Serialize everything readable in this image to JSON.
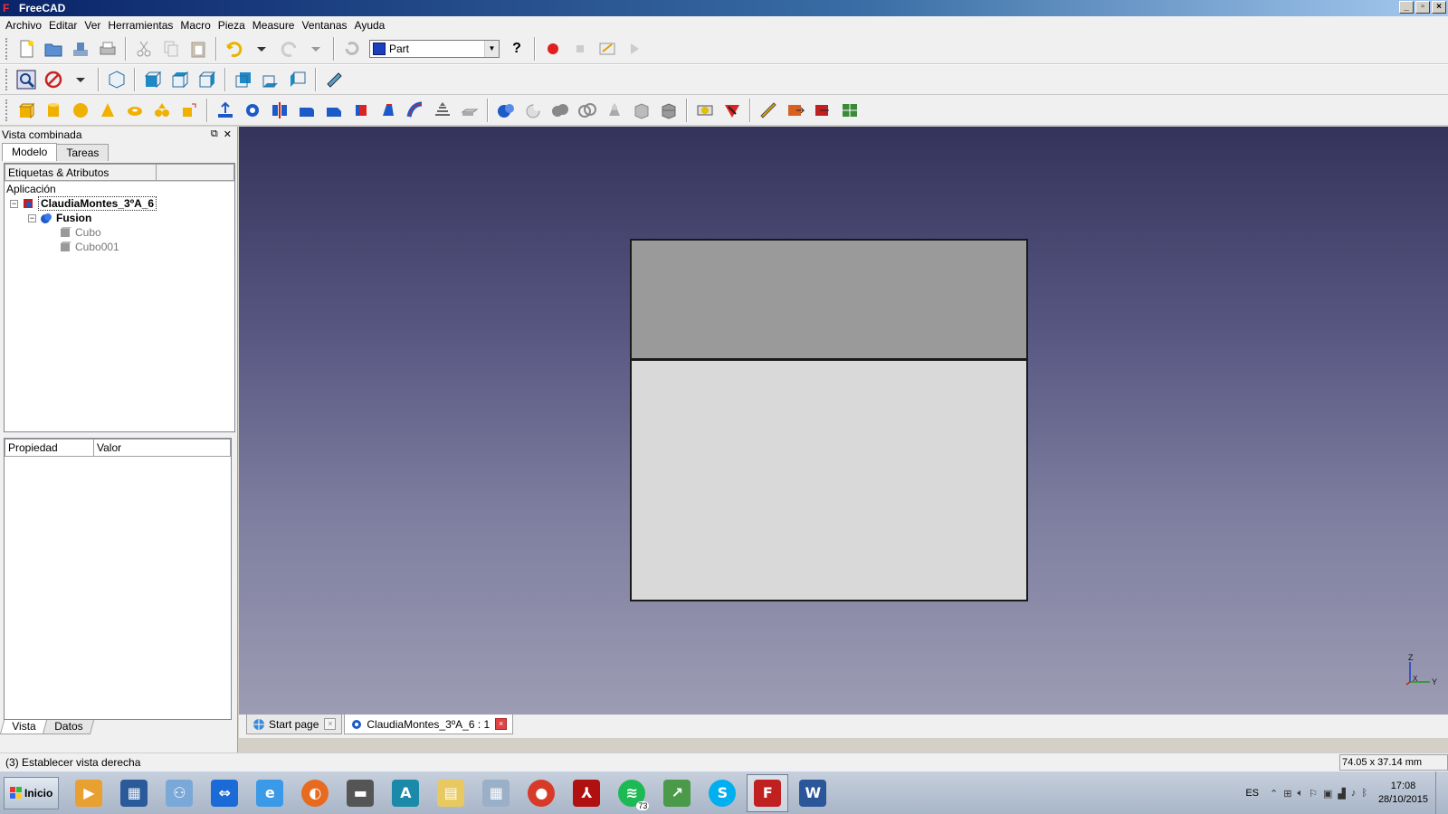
{
  "window": {
    "title": "FreeCAD",
    "buttons": [
      "_",
      "▫",
      "×"
    ]
  },
  "menu": [
    "Archivo",
    "Editar",
    "Ver",
    "Herramientas",
    "Macro",
    "Pieza",
    "Measure",
    "Ventanas",
    "Ayuda"
  ],
  "toolbar": {
    "workbench": "Part",
    "help_label": "?"
  },
  "left_panel": {
    "title": "Vista combinada",
    "tabs": [
      "Modelo",
      "Tareas"
    ],
    "tree_header": "Etiquetas & Atributos",
    "root_label": "Aplicación",
    "document": "ClaudiaMontes_3ºA_6",
    "fusion": "Fusion",
    "children": [
      "Cubo",
      "Cubo001"
    ],
    "prop_headers": [
      "Propiedad",
      "Valor"
    ],
    "bottom_tabs": [
      "Vista",
      "Datos"
    ]
  },
  "viewport": {
    "axis": {
      "z": "Z",
      "x": "X",
      "y": "Y"
    }
  },
  "doc_tabs": [
    {
      "label": "Start page",
      "close": "×"
    },
    {
      "label": "ClaudiaMontes_3ºA_6 : 1",
      "close": "×"
    }
  ],
  "status": {
    "message": "(3) Establecer vista derecha",
    "dimensions": "74.05 x 37.14 mm"
  },
  "taskbar": {
    "start_label": "Inicio",
    "language": "ES",
    "time": "17:08",
    "date": "28/10/2015",
    "spotify_badge": "73",
    "apps": [
      "media-player",
      "toolbox",
      "network",
      "teamviewer",
      "internet-explorer",
      "firefox",
      "scanner",
      "arduino",
      "file-explorer",
      "calculator",
      "chrome",
      "acrobat",
      "spotify",
      "chart-app",
      "skype",
      "freecad",
      "word"
    ]
  }
}
